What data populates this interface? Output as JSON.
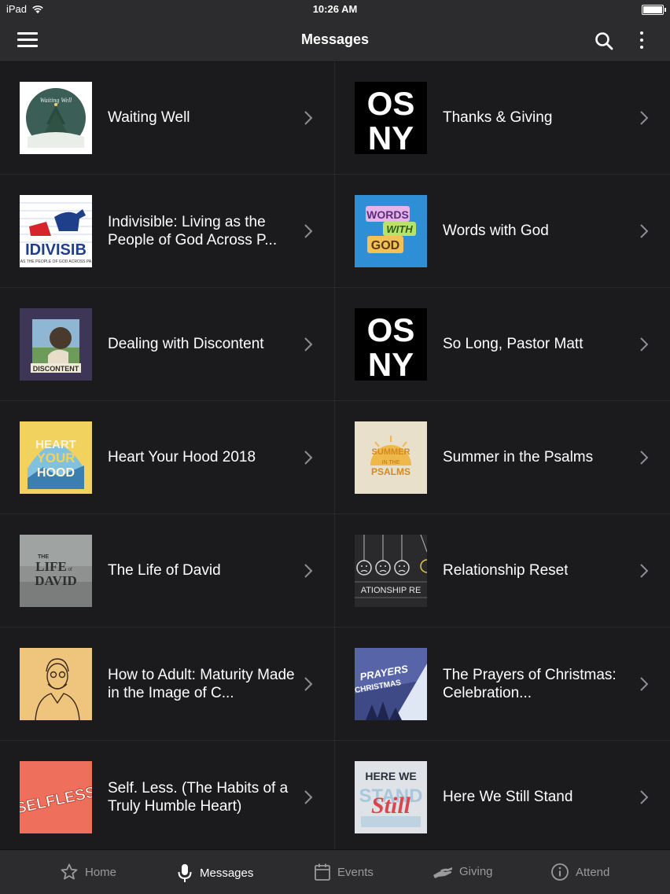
{
  "status": {
    "device": "iPad",
    "time": "10:26 AM"
  },
  "header": {
    "title": "Messages",
    "menu_icon": "hamburger-menu-icon",
    "search_icon": "search-icon",
    "more_icon": "more-vertical-icon"
  },
  "messages": [
    {
      "title": "Waiting Well",
      "art_text": [
        "Waiting Well"
      ]
    },
    {
      "title": "Thanks & Giving",
      "art_text": [
        "OS",
        "NY"
      ]
    },
    {
      "title": "Indivisible: Living as the People of God Across P...",
      "art_text": [
        "IDIVISIB",
        "AS THE PEOPLE OF GOD ACROSS PA"
      ]
    },
    {
      "title": "Words with God",
      "art_text": [
        "WORDS",
        "WITH",
        "GOD"
      ]
    },
    {
      "title": "Dealing with Discontent",
      "art_text": [
        "DISCONTENT"
      ]
    },
    {
      "title": "So Long, Pastor Matt",
      "art_text": [
        "OS",
        "NY"
      ]
    },
    {
      "title": "Heart Your Hood 2018",
      "art_text": [
        "HEART",
        "YOUR",
        "HOOD"
      ]
    },
    {
      "title": "Summer in the Psalms",
      "art_text": [
        "SUMMER",
        "IN THE",
        "PSALMS"
      ]
    },
    {
      "title": "The Life of David",
      "art_text": [
        "THE",
        "LIFE",
        "of",
        "DAVID"
      ]
    },
    {
      "title": "Relationship Reset",
      "art_text": [
        "ATIONSHIP RE"
      ]
    },
    {
      "title": "How to Adult: Maturity Made in the Image of C...",
      "art_text": []
    },
    {
      "title": "The Prayers of Christmas: Celebration...",
      "art_text": [
        "PRAYERS",
        "CHRISTMAS"
      ]
    },
    {
      "title": "Self. Less. (The Habits of a Truly Humble Heart)",
      "art_text": [
        "SELFLESS"
      ]
    },
    {
      "title": "Here We Still Stand",
      "art_text": [
        "HERE WE",
        "STAND",
        "Still"
      ]
    }
  ],
  "tabs": [
    {
      "label": "Home",
      "icon": "star-icon",
      "active": false
    },
    {
      "label": "Messages",
      "icon": "microphone-icon",
      "active": true
    },
    {
      "label": "Events",
      "icon": "calendar-icon",
      "active": false
    },
    {
      "label": "Giving",
      "icon": "giving-hands-icon",
      "active": false
    },
    {
      "label": "Attend",
      "icon": "info-circle-icon",
      "active": false
    }
  ],
  "colors": {
    "background": "#1b1b1d",
    "bar": "#2c2c2e",
    "divider": "#2a2a2c",
    "active_tab": "#ffffff",
    "inactive_tab": "#9a9a9c"
  }
}
